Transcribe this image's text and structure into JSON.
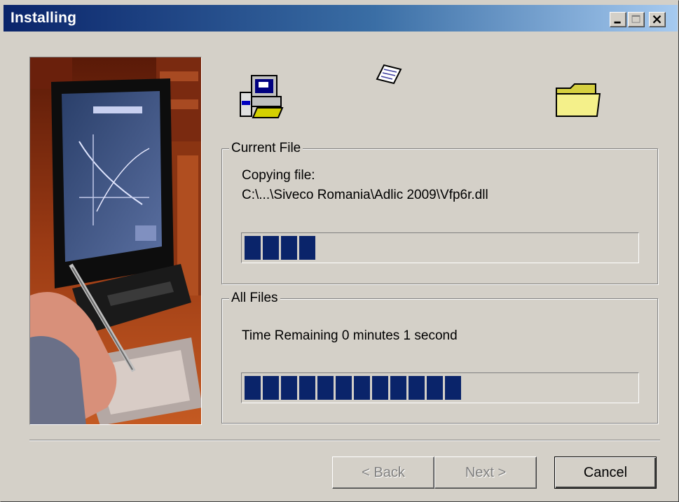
{
  "window": {
    "title": "Installing",
    "controls": {
      "minimize_icon": "minimize-icon",
      "maximize_icon": "maximize-icon",
      "close_icon": "close-icon"
    },
    "title_gradient": [
      "#0a246a",
      "#a6caf0"
    ]
  },
  "animation": {
    "source_icon": "computer-icon",
    "flying_icon": "flying-paper-icon",
    "target_icon": "folder-icon"
  },
  "current_file": {
    "group_title": "Current File",
    "status": "Copying file:",
    "path": "C:\\...\\Siveco Romania\\Adlic 2009\\Vfp6r.dll",
    "progress_blocks": 4
  },
  "all_files": {
    "group_title": "All Files",
    "time_remaining": "Time Remaining 0 minutes 1 second",
    "progress_blocks": 12
  },
  "buttons": {
    "back": "< Back",
    "next": "Next >",
    "cancel": "Cancel"
  },
  "colors": {
    "progress": "#0a246a",
    "face": "#d4d0c8"
  }
}
